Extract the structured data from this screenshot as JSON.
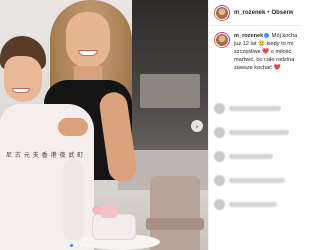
{
  "post": {
    "image_alt": "",
    "carousel": {
      "next_icon": "chevron-right-icon",
      "dot_count": 6,
      "active_index": 0
    }
  },
  "panel": {
    "header": {
      "username": "m_rozenek",
      "separator": "•",
      "follow_label": "Obserw"
    },
    "caption": {
      "username": "m_rozenek",
      "lines": [
        "Mój kocha",
        "już 12 lat 🙂 kiedy to mi",
        "szczęśliwe ❤️ o miłość",
        "martwić, bo całe rodzina",
        "zawsze kochać ❤️"
      ]
    },
    "comments_blurred": 5
  },
  "colors": {
    "accent": "#3897f0",
    "text": "#262626",
    "border": "#efefef"
  }
}
